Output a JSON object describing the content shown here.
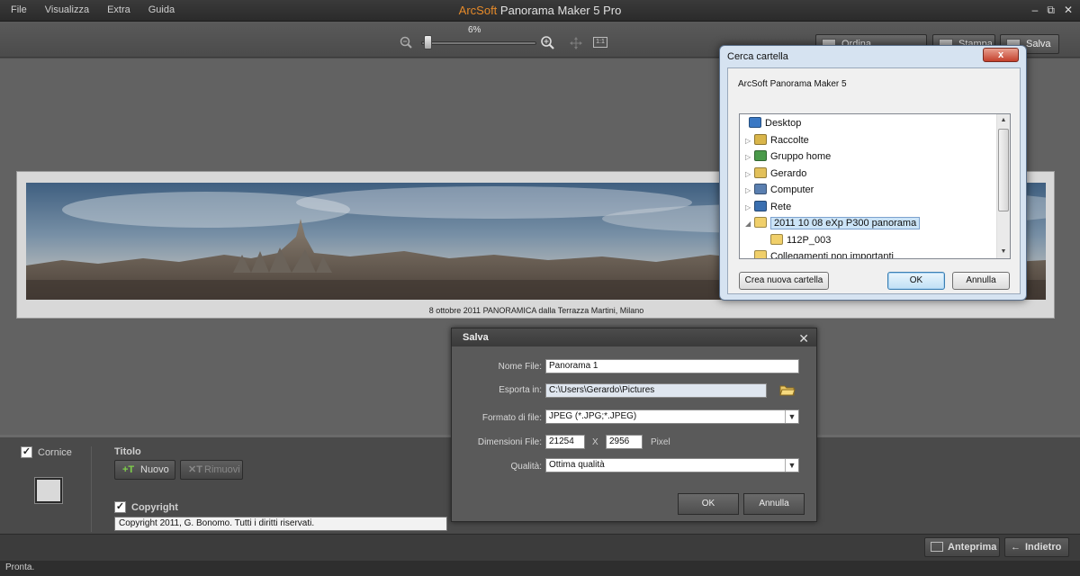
{
  "window": {
    "brand": "ArcSoft",
    "title": "Panorama Maker 5 Pro",
    "menu": [
      "File",
      "Visualizza",
      "Extra",
      "Guida"
    ],
    "controls": {
      "minimize": "‒",
      "restore": "⧉",
      "close": "✕"
    }
  },
  "toolbar": {
    "zoom_percent": "6%",
    "zoom_fraction": 0.06,
    "one_to_one": "1:1",
    "sort_label": "Ordina panoramiche",
    "print_label": "Stampa",
    "save_label": "Salva"
  },
  "panorama": {
    "caption": "8 ottobre 2011 PANORAMICA dalla Terrazza Martini, Milano"
  },
  "bottom": {
    "frame_label": "Cornice",
    "frame_checked": true,
    "title_label": "Titolo",
    "new_label": "Nuovo",
    "remove_label": "Rimuovi",
    "copyright_label": "Copyright",
    "copyright_checked": true,
    "copyright_text": "Copyright 2011, G. Bonomo. Tutti i diritti riservati.",
    "preview_label": "Anteprima",
    "back_label": "Indietro"
  },
  "status": {
    "text": "Pronta."
  },
  "save_dialog": {
    "title": "Salva",
    "file_name_label": "Nome File:",
    "file_name": "Panorama 1",
    "export_label": "Esporta in:",
    "export_path": "C:\\Users\\Gerardo\\Pictures",
    "format_label": "Formato di file:",
    "format": "JPEG (*.JPG;*.JPEG)",
    "dims_label": "Dimensioni File:",
    "width": "21254",
    "times": "X",
    "height": "2956",
    "unit": "Pixel",
    "quality_label": "Qualità:",
    "quality": "Ottima qualità",
    "ok": "OK",
    "cancel": "Annulla"
  },
  "folder_dialog": {
    "title": "Cerca cartella",
    "description": "ArcSoft Panorama Maker 5",
    "items": [
      {
        "label": "Desktop",
        "icon": "desktop-icon",
        "level": 0,
        "expander": ""
      },
      {
        "label": "Raccolte",
        "icon": "libraries-icon",
        "level": 1,
        "expander": "▷"
      },
      {
        "label": "Gruppo home",
        "icon": "homegroup-icon",
        "level": 1,
        "expander": "▷"
      },
      {
        "label": "Gerardo",
        "icon": "user-folder-icon",
        "level": 1,
        "expander": "▷"
      },
      {
        "label": "Computer",
        "icon": "computer-icon",
        "level": 1,
        "expander": "▷"
      },
      {
        "label": "Rete",
        "icon": "network-icon",
        "level": 1,
        "expander": "▷"
      },
      {
        "label": "2011 10 08 eXp P300 panorama",
        "icon": "folder-icon",
        "level": 1,
        "expander": "◢",
        "selected": true
      },
      {
        "label": "112P_003",
        "icon": "folder-icon",
        "level": 2,
        "expander": ""
      },
      {
        "label": "Collegamenti non importanti",
        "icon": "folder-icon",
        "level": 1,
        "expander": ""
      }
    ],
    "new_folder": "Crea nuova cartella",
    "ok": "OK",
    "cancel": "Annulla",
    "close": "x"
  }
}
